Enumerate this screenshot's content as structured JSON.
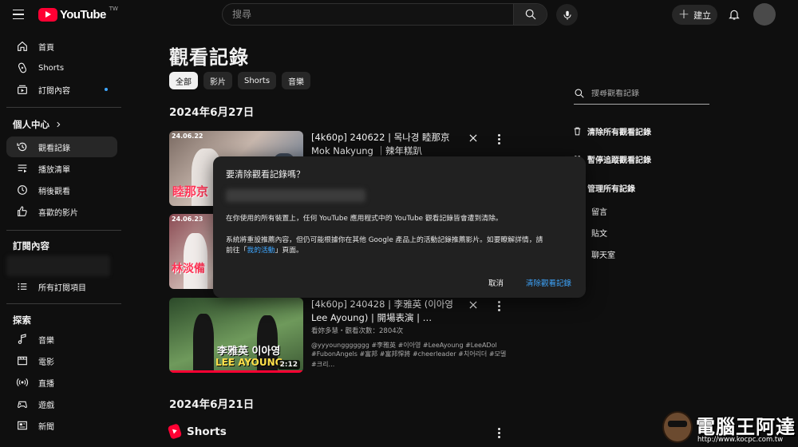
{
  "header": {
    "logo_text": "YouTube",
    "logo_region": "TW",
    "search_placeholder": "搜尋",
    "create_label": "建立"
  },
  "sidebar": {
    "main": [
      {
        "label": "首頁",
        "icon": "home-icon"
      },
      {
        "label": "Shorts",
        "icon": "shorts-icon"
      },
      {
        "label": "訂閱內容",
        "icon": "subscriptions-icon"
      }
    ],
    "you_heading": "個人中心",
    "you_items": [
      {
        "label": "觀看記錄",
        "icon": "history-icon",
        "active": true
      },
      {
        "label": "播放清單",
        "icon": "playlist-icon"
      },
      {
        "label": "稍後觀看",
        "icon": "watch-later-icon"
      },
      {
        "label": "喜歡的影片",
        "icon": "like-icon"
      }
    ],
    "subs_heading": "訂閱內容",
    "all_subs_label": "所有訂閱項目",
    "explore_heading": "探索",
    "explore_items": [
      {
        "label": "音樂",
        "icon": "music-icon"
      },
      {
        "label": "電影",
        "icon": "movie-icon"
      },
      {
        "label": "直播",
        "icon": "live-icon"
      },
      {
        "label": "遊戲",
        "icon": "gaming-icon"
      },
      {
        "label": "新聞",
        "icon": "news-icon"
      }
    ]
  },
  "main": {
    "title": "觀看記錄",
    "chips": [
      "全部",
      "影片",
      "Shorts",
      "音樂"
    ],
    "date1": "2024年6月27日",
    "date2": "2024年6月21日",
    "shorts_label": "Shorts",
    "videos": [
      {
        "title": "[4k60p] 240622 | 목나경 睦那京 Mok Nakyung ｜辣年糕趴 Korea…",
        "thumb_date": "24.06.22",
        "thumb_caption": "睦那京"
      },
      {
        "thumb_date": "24.06.23",
        "thumb_caption": "林淡備"
      },
      {
        "title": "[4k60p] 240428 | 李雅英 (이아영 Lee Ayoung) | 開場表演 | …",
        "meta": "看妳多慧・觀看次數：2804次",
        "desc1": "@yyyounggggggg #李雅英 #이아영 #LeeAyoung #LeeADol",
        "desc2": "#FubonAngels #富邦 #富邦悍將 #cheerleader #치어리더 #모델 #크리…",
        "thumb_caption_1": "李雅英 이아영",
        "thumb_caption_2": "LEE AYOUNG",
        "duration": "2:12",
        "progress": 1.0
      }
    ]
  },
  "right_panel": {
    "search_placeholder": "搜尋觀看記錄",
    "clear_all": "清除所有觀看記錄",
    "pause": "暫停追蹤觀看記錄",
    "manage": "管理所有記錄",
    "sub_items": [
      "留言",
      "貼文",
      "聊天室"
    ]
  },
  "dialog": {
    "title": "要清除觀看記錄嗎？",
    "line1": "在你使用的所有裝置上，任何 YouTube 應用程式中的 YouTube 觀看記錄皆會遭到清除。",
    "line2": "系統將重設推薦內容，但仍可能根據你在其他 Google 產品上的活動記錄推薦影片。如要瞭解詳情，請",
    "line3_pre": "前往「",
    "line3_link": "我的活動",
    "line3_post": "」頁面。",
    "cancel": "取消",
    "confirm": "清除觀看記錄"
  },
  "watermark": {
    "brand": "電腦王阿達",
    "url": "http://www.kocpc.com.tw"
  }
}
